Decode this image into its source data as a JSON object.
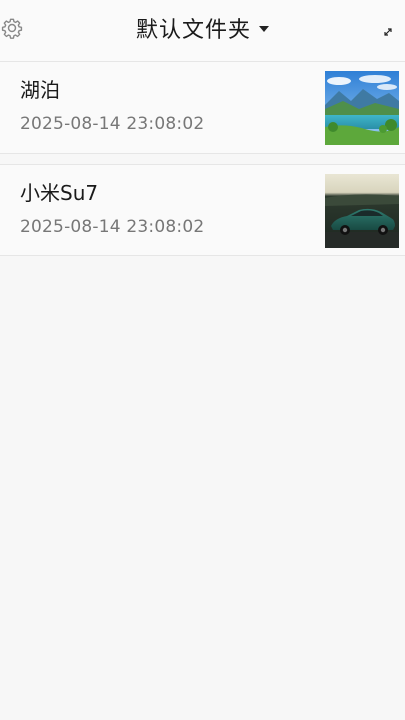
{
  "header": {
    "title": "默认文件夹",
    "settings_icon": "gear-icon",
    "dropdown_icon": "caret-down-icon",
    "expand_icon": "expand-icon"
  },
  "notes": [
    {
      "title": "湖泊",
      "time": "2025-08-14 23:08:02",
      "thumbnail": "lake-landscape-image"
    },
    {
      "title": "小米Su7",
      "time": "2025-08-14 23:08:02",
      "thumbnail": "green-car-image"
    }
  ]
}
